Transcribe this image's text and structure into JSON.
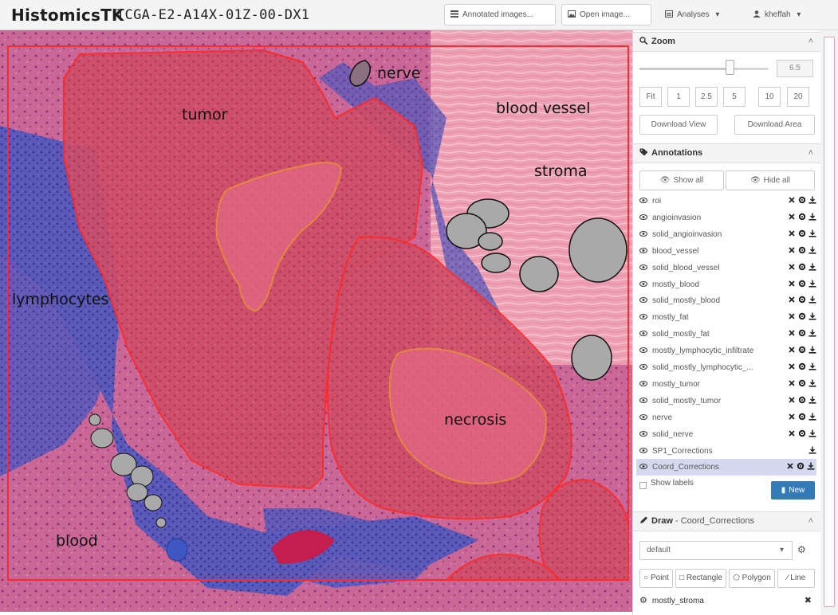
{
  "header": {
    "brand_prefix": "Histomics",
    "brand_suffix": "TK",
    "image_name": "TCGA-E2-A14X-01Z-00-DX1",
    "annotated_images_button": "Annotated images...",
    "open_image_button": "Open image...",
    "analyses_menu": "Analyses",
    "user_menu": "kheffah"
  },
  "viewer": {
    "labels": {
      "tumor": "tumor",
      "nerve": "nerve",
      "blood_vessel": "blood vessel",
      "stroma": "stroma",
      "lymphocytes": "lymphocytes",
      "necrosis": "necrosis",
      "blood": "blood"
    }
  },
  "zoom": {
    "title": "Zoom",
    "value": "6.5",
    "level_fraction": 0.7,
    "presets": [
      "Fit",
      "1",
      "2.5",
      "5",
      "10",
      "20"
    ],
    "download_view": "Download View",
    "download_area": "Download Area"
  },
  "annotations": {
    "title": "Annotations",
    "show_all": "Show all",
    "hide_all": "Hide all",
    "items": [
      {
        "name": "roi",
        "can_delete": true,
        "can_edit": true
      },
      {
        "name": "angioinvasion",
        "can_delete": true,
        "can_edit": true
      },
      {
        "name": "solid_angioinvasion",
        "can_delete": true,
        "can_edit": true
      },
      {
        "name": "blood_vessel",
        "can_delete": true,
        "can_edit": true
      },
      {
        "name": "solid_blood_vessel",
        "can_delete": true,
        "can_edit": true
      },
      {
        "name": "mostly_blood",
        "can_delete": true,
        "can_edit": true
      },
      {
        "name": "solid_mostly_blood",
        "can_delete": true,
        "can_edit": true
      },
      {
        "name": "mostly_fat",
        "can_delete": true,
        "can_edit": true
      },
      {
        "name": "solid_mostly_fat",
        "can_delete": true,
        "can_edit": true
      },
      {
        "name": "mostly_lymphocytic_infiltrate",
        "can_delete": true,
        "can_edit": true
      },
      {
        "name": "solid_mostly_lymphocytic_...",
        "can_delete": true,
        "can_edit": true
      },
      {
        "name": "mostly_tumor",
        "can_delete": true,
        "can_edit": true
      },
      {
        "name": "solid_mostly_tumor",
        "can_delete": true,
        "can_edit": true
      },
      {
        "name": "nerve",
        "can_delete": true,
        "can_edit": true
      },
      {
        "name": "solid_nerve",
        "can_delete": true,
        "can_edit": true
      },
      {
        "name": "SP1_Corrections",
        "can_delete": false,
        "can_edit": false
      },
      {
        "name": "Coord_Corrections",
        "can_delete": true,
        "can_edit": true,
        "active": true
      }
    ],
    "show_labels": "Show labels",
    "new_button": "New"
  },
  "draw": {
    "title": "Draw",
    "target": "- Coord_Corrections",
    "style_select": "default",
    "tools": [
      "Point",
      "Rectangle",
      "Polygon",
      "Line"
    ],
    "element": "mostly_stroma"
  },
  "colors": {
    "tumor_region": "#d84a63",
    "necrosis_outline": "#f0a030",
    "roi_outline": "#ff2a2a",
    "primary_button": "#337ab7",
    "active_row": "#d5d9ef"
  }
}
